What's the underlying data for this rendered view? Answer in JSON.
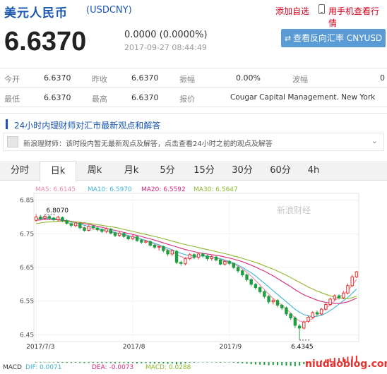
{
  "header": {
    "title": "美元人民币",
    "code": "(USDCNY)",
    "add_fav": "添加自选",
    "phone_link": "用手机查看行情"
  },
  "quote": {
    "price": "6.6370",
    "change": "0.0000 (0.0000%)",
    "timestamp": "2017-09-27 08:44:49",
    "reverse_button": "查看反向汇率 CNYUSD"
  },
  "stats": {
    "row1": [
      {
        "label": "今开",
        "value": "6.6370"
      },
      {
        "label": "昨收",
        "value": "6.6370"
      },
      {
        "label": "振幅",
        "value": "0.00%"
      },
      {
        "label": "波幅",
        "value": "0"
      }
    ],
    "row2": [
      {
        "label": "最低",
        "value": "6.6370"
      },
      {
        "label": "最高",
        "value": "6.6370"
      },
      {
        "label": "报价",
        "value": "Cougar Capital Management. New York"
      }
    ]
  },
  "news": {
    "title": "24小时内理财师对汇市最新观点和解答",
    "item": "新浪理财师：该时段内暂无最新观点及解答，点击查看24小时之前的观点及解答"
  },
  "tabs": [
    "分时",
    "日k",
    "周k",
    "月k",
    "5分",
    "15分",
    "30分",
    "60分",
    "4h"
  ],
  "active_tab": "日k",
  "ma_legend": {
    "ma5": "MA5: 6.6145",
    "ma10": "MA10: 6.5970",
    "ma20": "MA20: 6.5592",
    "ma30": "MA30: 6.5647"
  },
  "macd_legend": {
    "label": "MACD",
    "dif": "DIF: 0.0071",
    "dea": "DEA: -0.0073",
    "macd": "MACD: 0.0288"
  },
  "watermark": "新浪财经",
  "site_watermark": "niudaoblog.com",
  "colors": {
    "up": "#e8312f",
    "down": "#1e9e3f",
    "ma5": "#e98ba7",
    "ma10": "#3fb5d4",
    "ma20": "#d6287d",
    "ma30": "#8bb82c",
    "accent": "#1a56b0"
  },
  "chart_data": {
    "type": "candlestick",
    "yticks": [
      "6.85",
      "6.75",
      "6.65",
      "6.55",
      "6.45"
    ],
    "ylim": [
      6.43,
      6.87
    ],
    "xticks": [
      "2017/7/3",
      "2017/8",
      "2017/9"
    ],
    "annotations": [
      {
        "text": "6.8070",
        "value": 6.807
      },
      {
        "text": "6.4345",
        "value": 6.4345
      }
    ],
    "candles": [
      [
        6.79,
        6.8,
        6.808,
        6.786
      ],
      [
        6.8,
        6.795,
        6.806,
        6.79
      ],
      [
        6.796,
        6.802,
        6.807,
        6.792
      ],
      [
        6.801,
        6.797,
        6.805,
        6.791
      ],
      [
        6.797,
        6.792,
        6.8,
        6.788
      ],
      [
        6.792,
        6.799,
        6.803,
        6.787
      ],
      [
        6.798,
        6.789,
        6.801,
        6.785
      ],
      [
        6.789,
        6.781,
        6.793,
        6.777
      ],
      [
        6.78,
        6.775,
        6.785,
        6.769
      ],
      [
        6.774,
        6.782,
        6.786,
        6.77
      ],
      [
        6.781,
        6.768,
        6.784,
        6.763
      ],
      [
        6.767,
        6.76,
        6.771,
        6.756
      ],
      [
        6.76,
        6.772,
        6.776,
        6.757
      ],
      [
        6.772,
        6.768,
        6.776,
        6.762
      ],
      [
        6.767,
        6.762,
        6.771,
        6.757
      ],
      [
        6.762,
        6.757,
        6.766,
        6.752
      ],
      [
        6.757,
        6.765,
        6.769,
        6.752
      ],
      [
        6.764,
        6.752,
        6.767,
        6.748
      ],
      [
        6.752,
        6.745,
        6.756,
        6.74
      ],
      [
        6.745,
        6.752,
        6.756,
        6.741
      ],
      [
        6.751,
        6.742,
        6.755,
        6.738
      ],
      [
        6.741,
        6.735,
        6.745,
        6.731
      ],
      [
        6.735,
        6.742,
        6.746,
        6.731
      ],
      [
        6.741,
        6.73,
        6.744,
        6.726
      ],
      [
        6.731,
        6.725,
        6.735,
        6.72
      ],
      [
        6.725,
        6.728,
        6.732,
        6.721
      ],
      [
        6.727,
        6.716,
        6.73,
        6.712
      ],
      [
        6.716,
        6.71,
        6.72,
        6.705
      ],
      [
        6.71,
        6.712,
        6.715,
        6.7
      ],
      [
        6.712,
        6.7,
        6.715,
        6.695
      ],
      [
        6.7,
        6.69,
        6.704,
        6.684
      ],
      [
        6.69,
        6.7,
        6.704,
        6.684
      ],
      [
        6.698,
        6.665,
        6.702,
        6.66
      ],
      [
        6.665,
        6.662,
        6.67,
        6.655
      ],
      [
        6.661,
        6.676,
        6.68,
        6.656
      ],
      [
        6.676,
        6.688,
        6.692,
        6.672
      ],
      [
        6.688,
        6.68,
        6.692,
        6.675
      ],
      [
        6.68,
        6.69,
        6.694,
        6.674
      ],
      [
        6.69,
        6.684,
        6.694,
        6.679
      ],
      [
        6.684,
        6.676,
        6.688,
        6.67
      ],
      [
        6.676,
        6.682,
        6.686,
        6.67
      ],
      [
        6.681,
        6.672,
        6.684,
        6.668
      ],
      [
        6.672,
        6.66,
        6.676,
        6.656
      ],
      [
        6.66,
        6.668,
        6.672,
        6.655
      ],
      [
        6.668,
        6.662,
        6.672,
        6.656
      ],
      [
        6.662,
        6.65,
        6.665,
        6.645
      ],
      [
        6.65,
        6.64,
        6.654,
        6.634
      ],
      [
        6.64,
        6.628,
        6.644,
        6.622
      ],
      [
        6.628,
        6.614,
        6.632,
        6.608
      ],
      [
        6.614,
        6.6,
        6.618,
        6.594
      ],
      [
        6.6,
        6.59,
        6.604,
        6.584
      ],
      [
        6.59,
        6.578,
        6.594,
        6.572
      ],
      [
        6.578,
        6.564,
        6.582,
        6.558
      ],
      [
        6.564,
        6.548,
        6.568,
        6.542
      ],
      [
        6.548,
        6.552,
        6.558,
        6.54
      ],
      [
        6.552,
        6.538,
        6.556,
        6.532
      ],
      [
        6.538,
        6.53,
        6.542,
        6.524
      ],
      [
        6.53,
        6.512,
        6.534,
        6.505
      ],
      [
        6.512,
        6.5,
        6.516,
        6.494
      ],
      [
        6.5,
        6.478,
        6.505,
        6.47
      ],
      [
        6.476,
        6.47,
        6.482,
        6.4345
      ],
      [
        6.47,
        6.488,
        6.492,
        6.466
      ],
      [
        6.49,
        6.502,
        6.508,
        6.486
      ],
      [
        6.502,
        6.516,
        6.52,
        6.498
      ],
      [
        6.516,
        6.512,
        6.522,
        6.508
      ],
      [
        6.512,
        6.526,
        6.53,
        6.508
      ],
      [
        6.526,
        6.54,
        6.544,
        6.522
      ],
      [
        6.54,
        6.556,
        6.56,
        6.536
      ],
      [
        6.556,
        6.566,
        6.57,
        6.55
      ],
      [
        6.566,
        6.56,
        6.57,
        6.555
      ],
      [
        6.56,
        6.574,
        6.58,
        6.556
      ],
      [
        6.574,
        6.596,
        6.602,
        6.57
      ],
      [
        6.596,
        6.622,
        6.628,
        6.592
      ],
      [
        6.622,
        6.637,
        6.64,
        6.618
      ]
    ],
    "ma": {
      "MA5": [
        6.795,
        6.798,
        6.799,
        6.797,
        6.794,
        6.792,
        6.789,
        6.784,
        6.779,
        6.776,
        6.772,
        6.768,
        6.766,
        6.764,
        6.762,
        6.76,
        6.758,
        6.755,
        6.752,
        6.75,
        6.747,
        6.743,
        6.74,
        6.737,
        6.733,
        6.729,
        6.724,
        6.719,
        6.714,
        6.708,
        6.702,
        6.696,
        6.689,
        6.682,
        6.678,
        6.678,
        6.68,
        6.683,
        6.685,
        6.683,
        6.681,
        6.678,
        6.674,
        6.669,
        6.665,
        6.66,
        6.654,
        6.646,
        6.636,
        6.624,
        6.611,
        6.598,
        6.584,
        6.571,
        6.558,
        6.548,
        6.538,
        6.527,
        6.514,
        6.5,
        6.491,
        6.488,
        6.491,
        6.498,
        6.508,
        6.518,
        6.528,
        6.54,
        6.552,
        6.561,
        6.57,
        6.582,
        6.597,
        6.614
      ],
      "MA10": [
        6.793,
        6.795,
        6.796,
        6.796,
        6.795,
        6.793,
        6.791,
        6.788,
        6.785,
        6.782,
        6.779,
        6.775,
        6.772,
        6.769,
        6.766,
        6.763,
        6.76,
        6.757,
        6.754,
        6.751,
        6.748,
        6.745,
        6.741,
        6.738,
        6.734,
        6.73,
        6.726,
        6.722,
        6.717,
        6.712,
        6.707,
        6.702,
        6.697,
        6.692,
        6.688,
        6.685,
        6.684,
        6.684,
        6.684,
        6.683,
        6.681,
        6.679,
        6.676,
        6.672,
        6.668,
        6.663,
        6.657,
        6.65,
        6.642,
        6.634,
        6.625,
        6.614,
        6.603,
        6.592,
        6.581,
        6.57,
        6.559,
        6.548,
        6.537,
        6.526,
        6.517,
        6.51,
        6.506,
        6.504,
        6.505,
        6.508,
        6.514,
        6.522,
        6.531,
        6.541,
        6.551,
        6.561,
        6.573,
        6.586
      ],
      "MA20": [
        6.79,
        6.791,
        6.792,
        6.792,
        6.792,
        6.791,
        6.79,
        6.789,
        6.787,
        6.785,
        6.783,
        6.78,
        6.778,
        6.775,
        6.772,
        6.769,
        6.766,
        6.763,
        6.76,
        6.757,
        6.754,
        6.751,
        6.748,
        6.745,
        6.742,
        6.738,
        6.735,
        6.731,
        6.727,
        6.723,
        6.719,
        6.715,
        6.711,
        6.707,
        6.703,
        6.7,
        6.697,
        6.694,
        6.692,
        6.69,
        6.688,
        6.686,
        6.684,
        6.681,
        6.678,
        6.675,
        6.671,
        6.667,
        6.662,
        6.657,
        6.651,
        6.645,
        6.639,
        6.632,
        6.625,
        6.617,
        6.609,
        6.601,
        6.593,
        6.584,
        6.576,
        6.569,
        6.563,
        6.558,
        6.553,
        6.549,
        6.546,
        6.544,
        6.543,
        6.543,
        6.545,
        6.548,
        6.553,
        6.559
      ],
      "MA30": [
        6.78,
        6.782,
        6.784,
        6.785,
        6.786,
        6.787,
        6.787,
        6.787,
        6.786,
        6.785,
        6.784,
        6.783,
        6.781,
        6.779,
        6.777,
        6.775,
        6.773,
        6.771,
        6.769,
        6.766,
        6.763,
        6.76,
        6.757,
        6.754,
        6.751,
        6.748,
        6.745,
        6.742,
        6.739,
        6.735,
        6.732,
        6.728,
        6.725,
        6.721,
        6.718,
        6.715,
        6.712,
        6.709,
        6.706,
        6.703,
        6.7,
        6.697,
        6.694,
        6.691,
        6.688,
        6.684,
        6.681,
        6.677,
        6.673,
        6.669,
        6.665,
        6.66,
        6.655,
        6.65,
        6.645,
        6.639,
        6.633,
        6.627,
        6.62,
        6.613,
        6.606,
        6.599,
        6.592,
        6.586,
        6.58,
        6.575,
        6.57,
        6.566,
        6.562,
        6.56,
        6.558,
        6.558,
        6.56,
        6.565
      ]
    },
    "macd": [
      -0.002,
      -0.002,
      -0.001,
      -0.002,
      -0.002,
      -0.003,
      -0.003,
      -0.004,
      -0.004,
      -0.003,
      -0.004,
      -0.005,
      -0.004,
      -0.004,
      -0.004,
      -0.005,
      -0.004,
      -0.005,
      -0.006,
      -0.005,
      -0.005,
      -0.006,
      -0.005,
      -0.006,
      -0.006,
      -0.005,
      -0.006,
      -0.007,
      -0.006,
      -0.007,
      -0.008,
      -0.006,
      -0.01,
      -0.009,
      -0.006,
      -0.003,
      -0.003,
      -0.001,
      -0.001,
      -0.002,
      -0.001,
      -0.002,
      -0.003,
      -0.002,
      -0.002,
      -0.003,
      -0.005,
      -0.006,
      -0.008,
      -0.01,
      -0.011,
      -0.012,
      -0.013,
      -0.015,
      -0.013,
      -0.014,
      -0.015,
      -0.016,
      -0.017,
      -0.019,
      -0.016,
      -0.01,
      -0.004,
      0.002,
      0.004,
      0.008,
      0.012,
      0.016,
      0.019,
      0.018,
      0.021,
      0.024,
      0.027,
      0.029
    ]
  }
}
